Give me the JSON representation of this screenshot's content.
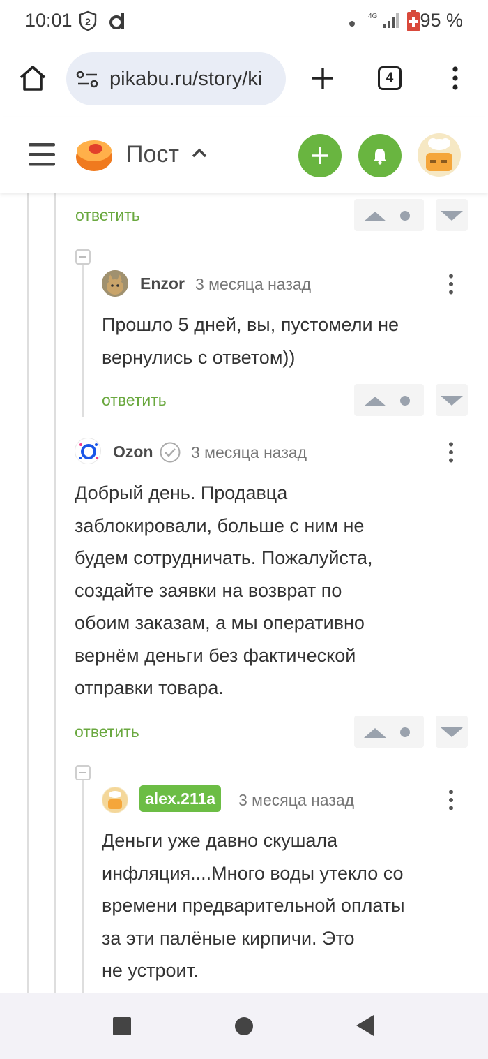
{
  "status_bar": {
    "time": "10:01",
    "notification_count": "2",
    "network": "4G",
    "battery": "95 %"
  },
  "browser": {
    "url": "pikabu.ru/story/ki",
    "tab_count": "4"
  },
  "site_header": {
    "title": "Пост"
  },
  "colors": {
    "accent_green": "#69b540",
    "reply_green": "#6aa83f"
  },
  "comments": {
    "top_reply": "ответить",
    "enzor": {
      "author": "Enzor",
      "time": "3 месяца назад",
      "text_lines": [
        "Прошло 5 дней, вы, пустомели не",
        "вернулись с ответом))"
      ],
      "reply": "ответить"
    },
    "ozon": {
      "author": "Ozon",
      "time": "3 месяца назад",
      "text_lines": [
        "Добрый день. Продавца",
        "заблокировали, больше с ним не",
        "будем сотрудничать. Пожалуйста,",
        "создайте заявки на возврат по",
        "обоим заказам, а мы оперативно",
        "вернём деньги без фактической",
        "отправки товара."
      ],
      "reply": "ответить"
    },
    "alex": {
      "author": "alex.211a",
      "time": "3 месяца назад",
      "text_lines": [
        "Деньги уже давно скушала",
        "инфляция....Много воды утекло со",
        "времени предварительной оплаты",
        "за эти палёные кирпичи. Это",
        "не устроит."
      ]
    }
  }
}
